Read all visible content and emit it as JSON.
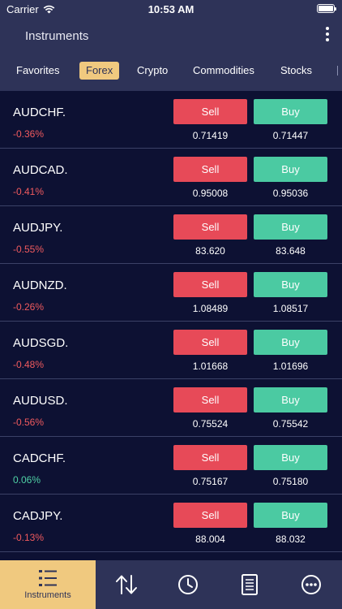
{
  "status_bar": {
    "carrier": "Carrier",
    "time": "10:53 AM"
  },
  "header": {
    "title": "Instruments"
  },
  "tabs": [
    {
      "label": "Favorites",
      "active": false
    },
    {
      "label": "Forex",
      "active": true
    },
    {
      "label": "Crypto",
      "active": false
    },
    {
      "label": "Commodities",
      "active": false
    },
    {
      "label": "Stocks",
      "active": false
    }
  ],
  "instruments": [
    {
      "symbol": "AUDCHF.",
      "change": "-0.36%",
      "sell_label": "Sell",
      "buy_label": "Buy",
      "bid": "0.71419",
      "ask": "0.71447"
    },
    {
      "symbol": "AUDCAD.",
      "change": "-0.41%",
      "sell_label": "Sell",
      "buy_label": "Buy",
      "bid": "0.95008",
      "ask": "0.95036"
    },
    {
      "symbol": "AUDJPY.",
      "change": "-0.55%",
      "sell_label": "Sell",
      "buy_label": "Buy",
      "bid": "83.620",
      "ask": "83.648"
    },
    {
      "symbol": "AUDNZD.",
      "change": "-0.26%",
      "sell_label": "Sell",
      "buy_label": "Buy",
      "bid": "1.08489",
      "ask": "1.08517"
    },
    {
      "symbol": "AUDSGD.",
      "change": "-0.48%",
      "sell_label": "Sell",
      "buy_label": "Buy",
      "bid": "1.01668",
      "ask": "1.01696"
    },
    {
      "symbol": "AUDUSD.",
      "change": "-0.56%",
      "sell_label": "Sell",
      "buy_label": "Buy",
      "bid": "0.75524",
      "ask": "0.75542"
    },
    {
      "symbol": "CADCHF.",
      "change": "0.06%",
      "sell_label": "Sell",
      "buy_label": "Buy",
      "bid": "0.75167",
      "ask": "0.75180"
    },
    {
      "symbol": "CADJPY.",
      "change": "-0.13%",
      "sell_label": "Sell",
      "buy_label": "Buy",
      "bid": "88.004",
      "ask": "88.032"
    }
  ],
  "bottom_nav": [
    {
      "label": "Instruments",
      "icon": "list-icon",
      "active": true
    },
    {
      "label": "",
      "icon": "up-down-arrows-icon",
      "active": false
    },
    {
      "label": "",
      "icon": "clock-icon",
      "active": false
    },
    {
      "label": "",
      "icon": "document-icon",
      "active": false
    },
    {
      "label": "",
      "icon": "more-horizontal-icon",
      "active": false
    }
  ],
  "colors": {
    "background": "#0d1133",
    "header": "#2e3358",
    "accent": "#f0c97f",
    "sell": "#e74a58",
    "buy": "#4bcaa2",
    "negative": "#f05a5e",
    "positive": "#4fd1a5"
  }
}
